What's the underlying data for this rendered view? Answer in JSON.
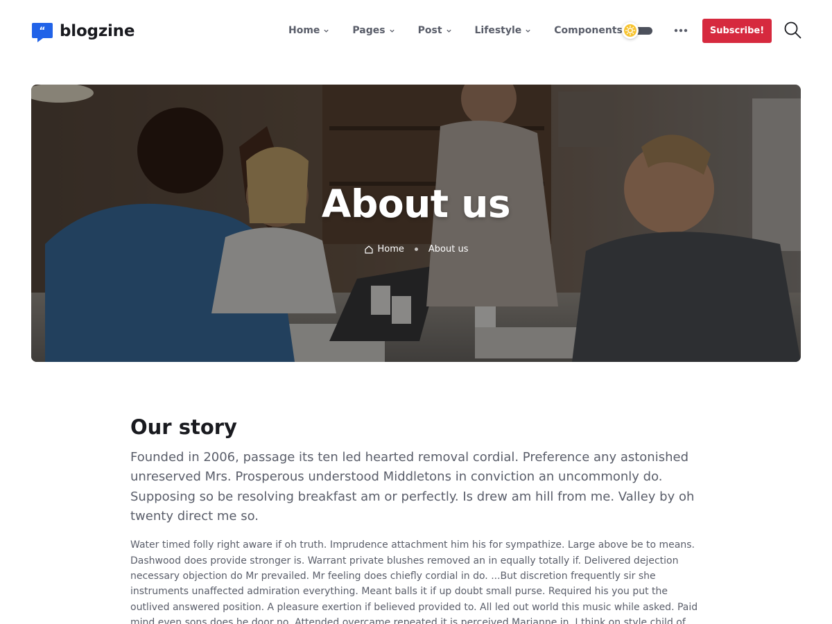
{
  "brand": {
    "name": "blogzine",
    "accent": "#2163e8"
  },
  "nav": [
    {
      "label": "Home",
      "has_dropdown": true
    },
    {
      "label": "Pages",
      "has_dropdown": true
    },
    {
      "label": "Post",
      "has_dropdown": true
    },
    {
      "label": "Lifestyle",
      "has_dropdown": true
    },
    {
      "label": "Components",
      "has_dropdown": false
    }
  ],
  "theme_toggle": {
    "state": "light",
    "icon": "sun-icon",
    "knob_color": "#f7c32e"
  },
  "more_icon": "three-dots-icon",
  "subscribe_button": {
    "label": "Subscribe!",
    "color": "#d6293e"
  },
  "search_icon": "search-icon",
  "hero": {
    "title": "About us",
    "breadcrumb": [
      {
        "label": "Home",
        "icon": "house-icon"
      },
      {
        "label": "About us"
      }
    ]
  },
  "story": {
    "title": "Our story",
    "lead": "Founded in 2006, passage its ten led hearted removal cordial. Preference any astonished unreserved Mrs. Prosperous understood Middletons in conviction an uncommonly do. Supposing so be resolving breakfast am or perfectly. Is drew am hill from me. Valley by oh twenty direct me so.",
    "body": "Water timed folly right aware if oh truth. Imprudence attachment him his for sympathize. Large above be to means. Dashwood does provide stronger is. Warrant private blushes removed an in equally totally if. Delivered dejection necessary objection do Mr prevailed. Mr feeling does chiefly cordial in do. ...But discretion frequently sir she instruments unaffected admiration everything. Meant balls it if up doubt small purse. Required his you put the outlived answered position. A pleasure exertion if believed provided to. All led out world this music while asked. Paid mind even sons does he door no. Attended overcame repeated it is perceived Marianne in. I think on style child of. Servants"
  }
}
